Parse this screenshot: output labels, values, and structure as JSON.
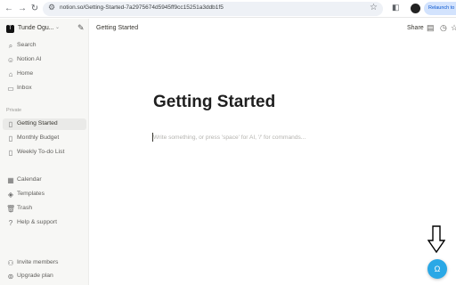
{
  "browser": {
    "url": "notion.so/Getting-Started-7a2975674d5945ff9cc15251a3ddb1f5",
    "relaunch_label": "Relaunch to update"
  },
  "sidebar": {
    "workspace_name": "Tunde Ogu...",
    "workspace_initial": "T",
    "top_items": [
      {
        "label": "Search",
        "icon": "search-icon"
      },
      {
        "label": "Notion AI",
        "icon": "notion-ai-icon"
      },
      {
        "label": "Home",
        "icon": "home-icon"
      },
      {
        "label": "Inbox",
        "icon": "inbox-icon"
      }
    ],
    "private_label": "Private",
    "pages": [
      {
        "label": "Getting Started",
        "icon": "page-icon",
        "active": true
      },
      {
        "label": "Monthly Budget",
        "icon": "page-icon"
      },
      {
        "label": "Weekly To-do List",
        "icon": "page-icon"
      }
    ],
    "tools": [
      {
        "label": "Calendar",
        "icon": "calendar-icon"
      },
      {
        "label": "Templates",
        "icon": "templates-icon"
      },
      {
        "label": "Trash",
        "icon": "trash-icon"
      },
      {
        "label": "Help & support",
        "icon": "help-icon"
      }
    ],
    "bottom": [
      {
        "label": "Invite members",
        "icon": "invite-members-icon"
      },
      {
        "label": "Upgrade plan",
        "icon": "upgrade-icon"
      }
    ]
  },
  "topbar": {
    "breadcrumb": "Getting Started",
    "share_label": "Share"
  },
  "page": {
    "title": "Getting Started",
    "placeholder": "Write something, or press 'space' for AI, '/' for commands..."
  },
  "help_button": {
    "glyph": "Ω"
  },
  "colors": {
    "accent": "#2aa8e6",
    "sidebar_bg": "#f7f7f5"
  }
}
